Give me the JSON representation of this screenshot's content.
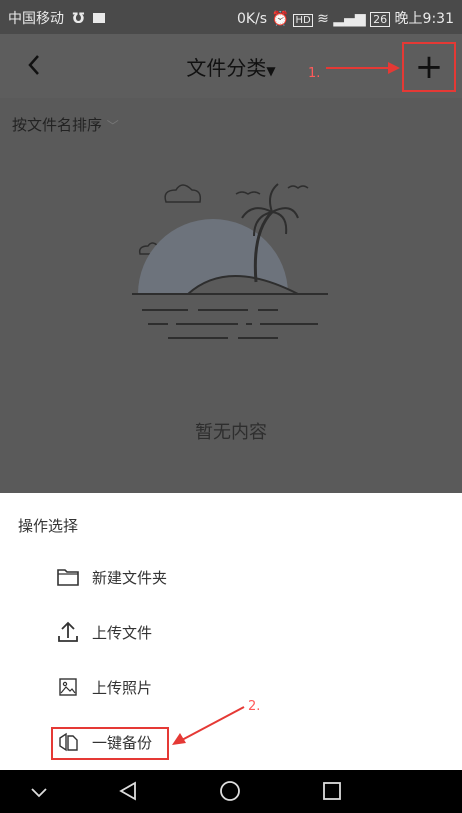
{
  "status_bar": {
    "carrier": "中国移动",
    "speed": "0K/s",
    "battery": "26",
    "time": "晚上9:31",
    "icons": [
      "usb-icon",
      "notification-icon",
      "alarm-icon",
      "hd-icon",
      "wifi-icon",
      "signal-icon",
      "battery-icon"
    ]
  },
  "header": {
    "title": "文件分类",
    "title_dropdown_icon": "caret-down-icon",
    "back_icon": "chevron-left-icon",
    "add_icon": "plus-icon",
    "annotation_1": "1."
  },
  "sort": {
    "label": "按文件名排序",
    "icon": "chevron-down-icon"
  },
  "empty_state": {
    "text": "暂无内容",
    "illustration": "island-palm-icon"
  },
  "action_sheet": {
    "title": "操作选择",
    "items": [
      {
        "label": "新建文件夹",
        "icon": "folder-icon"
      },
      {
        "label": "上传文件",
        "icon": "upload-icon"
      },
      {
        "label": "上传照片",
        "icon": "image-icon"
      },
      {
        "label": "一键备份",
        "icon": "backup-icon"
      }
    ],
    "annotation_2": "2."
  },
  "nav_bar": {
    "icons": [
      "chevron-down-icon",
      "back-triangle-icon",
      "home-circle-icon",
      "recents-square-icon"
    ]
  },
  "colors": {
    "overlay": "#5a5a5a",
    "highlight": "#e53935",
    "sheet_bg": "#ffffff"
  }
}
